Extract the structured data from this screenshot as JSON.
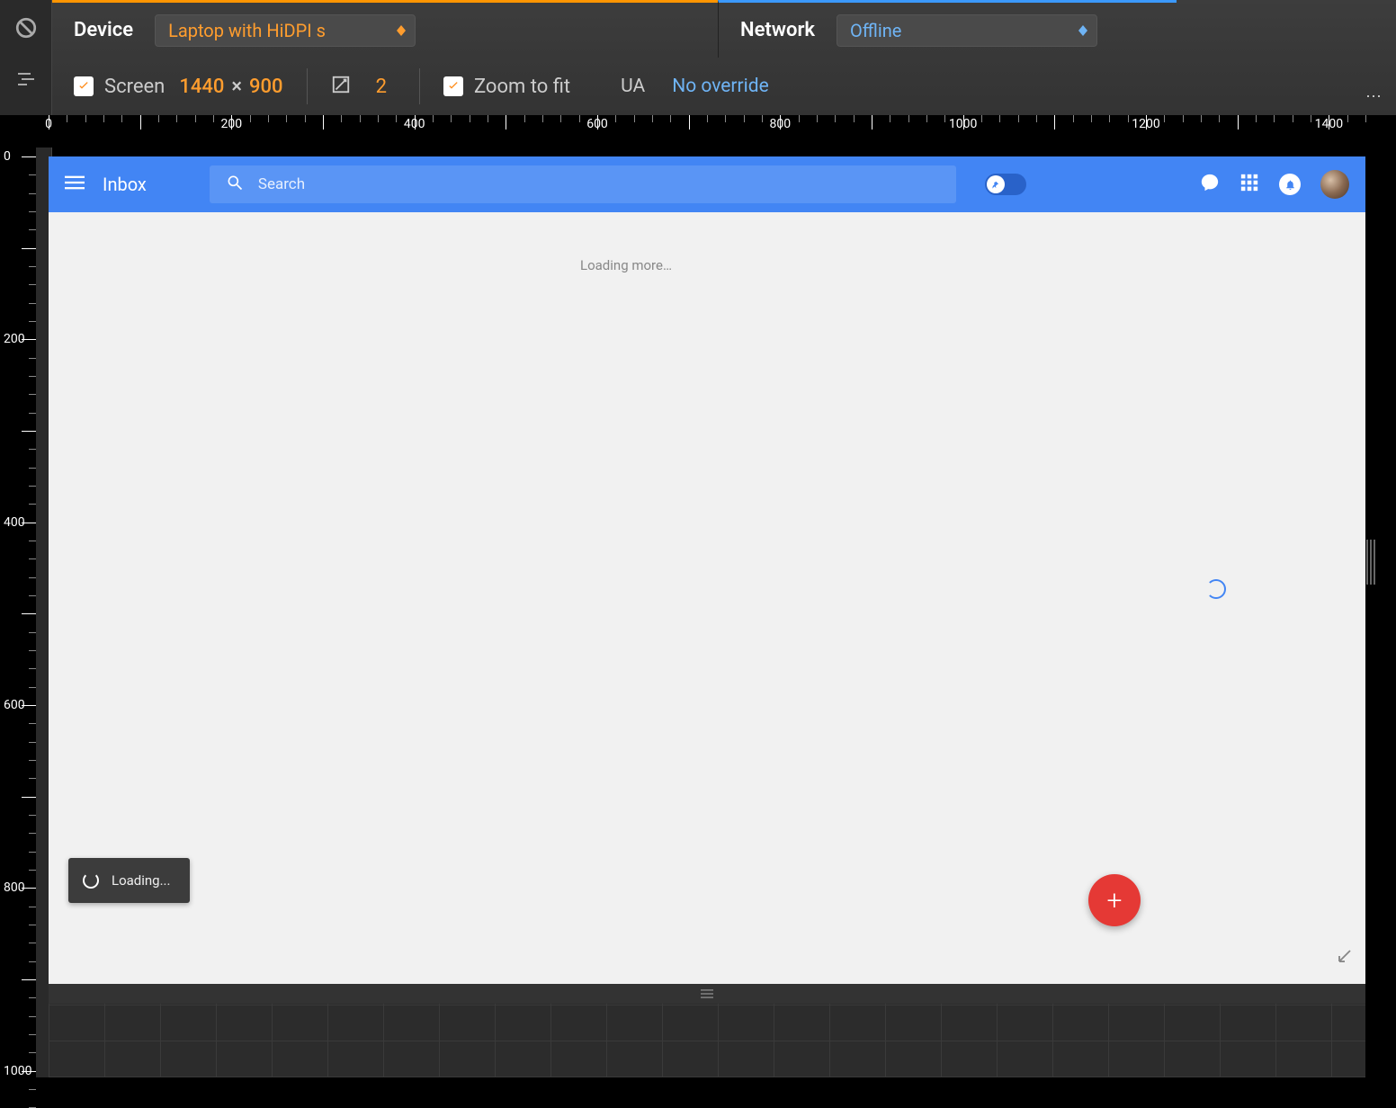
{
  "devtools": {
    "device_label": "Device",
    "device_value": "Laptop with HiDPI s",
    "network_label": "Network",
    "network_value": "Offline",
    "screen_checkbox": "Screen",
    "width": "1440",
    "height": "900",
    "dpr": "2",
    "zoom_checkbox": "Zoom to fit",
    "ua_label": "UA",
    "ua_value": "No override"
  },
  "ruler_marks": [
    "0",
    "200",
    "400",
    "600",
    "800",
    "1000",
    "1200",
    "1400"
  ],
  "ruler_v_marks": [
    "0",
    "200",
    "400",
    "600",
    "800",
    "1000"
  ],
  "inbox": {
    "title": "Inbox",
    "search_placeholder": "Search",
    "loading_more": "Loading more…",
    "toast": "Loading...",
    "fab": "+"
  }
}
